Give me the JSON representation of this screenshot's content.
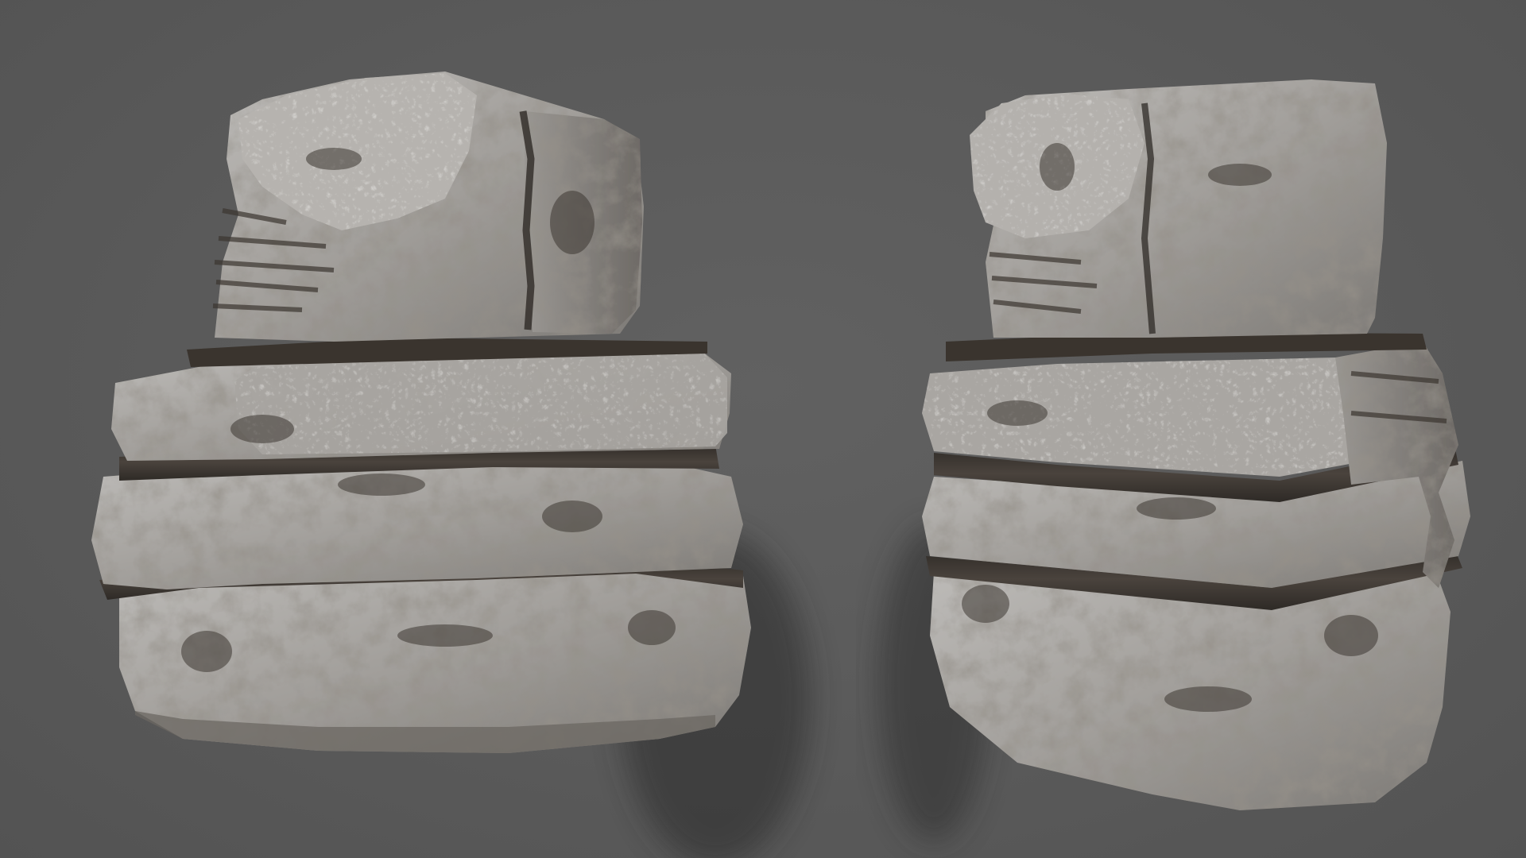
{
  "scene": {
    "background_color": "#5a5a5a",
    "objects": [
      {
        "name": "rock-left",
        "material": "weathered-limestone"
      },
      {
        "name": "rock-right",
        "material": "weathered-limestone"
      }
    ],
    "colors": {
      "stone_light": "#b3b1ae",
      "stone_mid": "#8f8c88",
      "stone_dark": "#4a4540",
      "grime": "#3d3731",
      "shadow": "#262626"
    }
  }
}
